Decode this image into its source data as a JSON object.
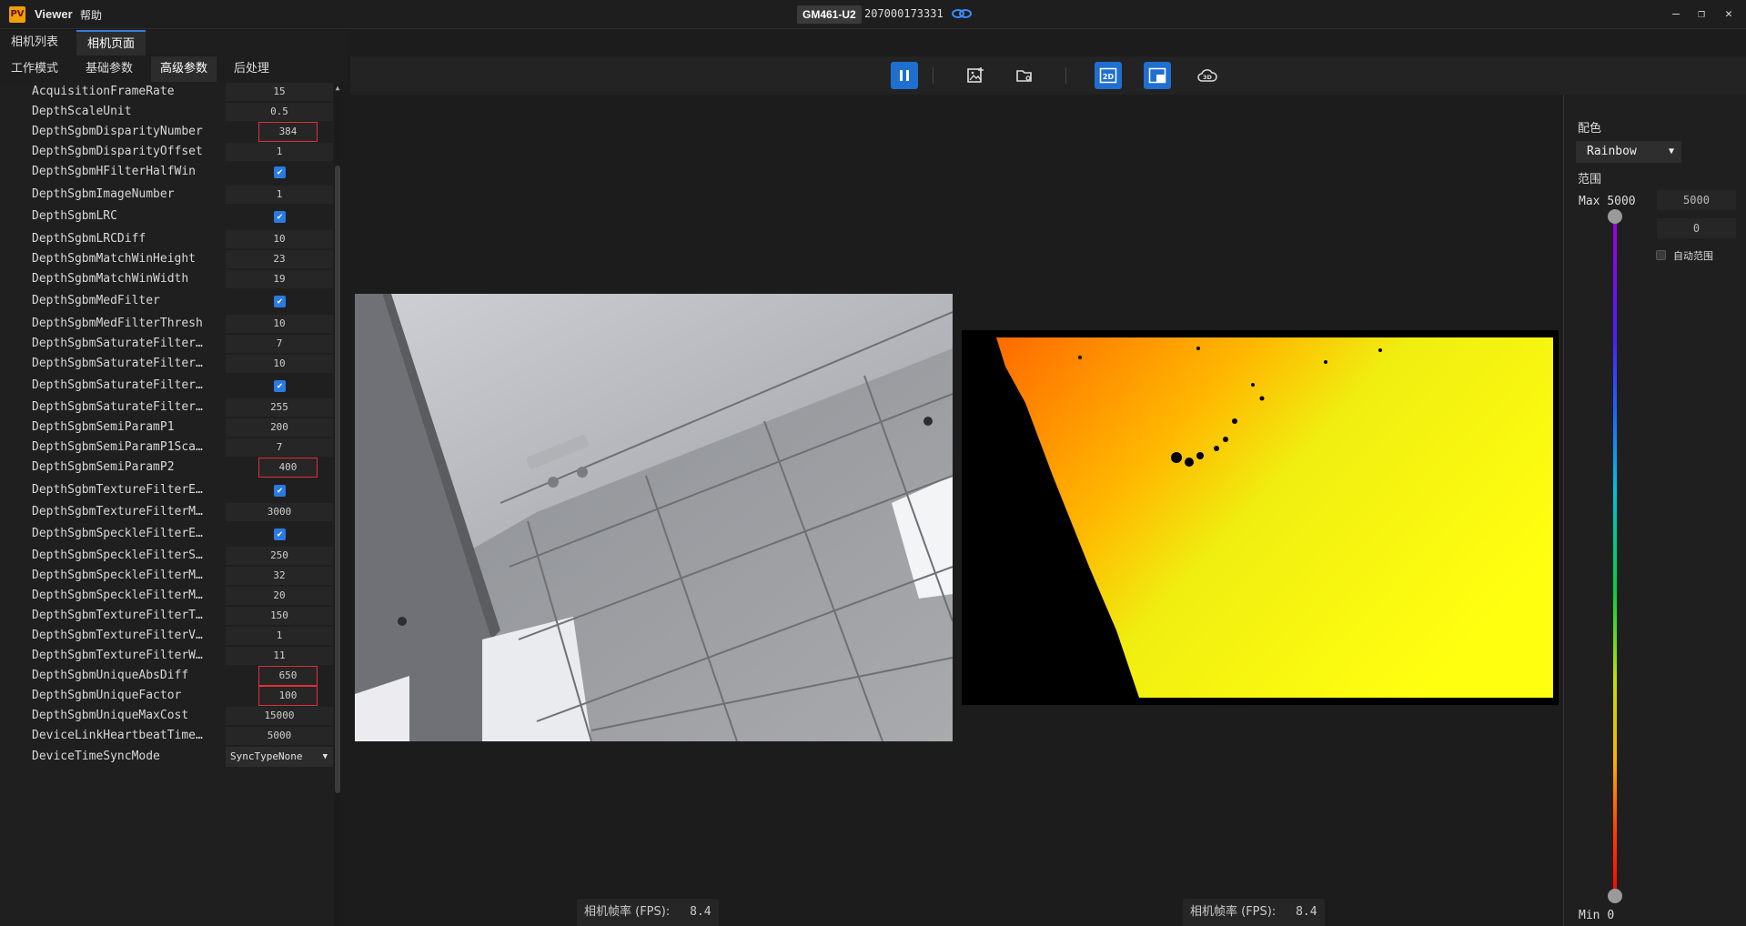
{
  "titlebar": {
    "logo_text": "PV",
    "app_title": "Viewer",
    "menu_help": "帮助",
    "camera_model": "GM461-U2",
    "camera_serial": "207000173331",
    "minimize": "–",
    "restore": "❐",
    "close": "✕"
  },
  "tabs_top": [
    "相机列表",
    "相机页面"
  ],
  "tabs_params": [
    "工作模式",
    "基础参数",
    "高级参数",
    "后处理"
  ],
  "params": [
    {
      "name": "AcquisitionFrameRate",
      "value": "15"
    },
    {
      "name": "DepthScaleUnit",
      "value": "0.5"
    },
    {
      "name": "DepthSgbmDisparityNumber",
      "value": "384",
      "highlight": true
    },
    {
      "name": "DepthSgbmDisparityOffset",
      "value": "1"
    },
    {
      "name": "DepthSgbmHFilterHalfWin",
      "checkbox": true
    },
    {
      "name": "DepthSgbmImageNumber",
      "value": "1"
    },
    {
      "name": "DepthSgbmLRC",
      "checkbox": true
    },
    {
      "name": "DepthSgbmLRCDiff",
      "value": "10"
    },
    {
      "name": "DepthSgbmMatchWinHeight",
      "value": "23"
    },
    {
      "name": "DepthSgbmMatchWinWidth",
      "value": "19"
    },
    {
      "name": "DepthSgbmMedFilter",
      "checkbox": true
    },
    {
      "name": "DepthSgbmMedFilterThresh",
      "value": "10"
    },
    {
      "name": "DepthSgbmSaturateFilter…",
      "value": "7"
    },
    {
      "name": "DepthSgbmSaturateFilter…",
      "value": "10"
    },
    {
      "name": "DepthSgbmSaturateFilter…",
      "checkbox": true
    },
    {
      "name": "DepthSgbmSaturateFilter…",
      "value": "255"
    },
    {
      "name": "DepthSgbmSemiParamP1",
      "value": "200"
    },
    {
      "name": "DepthSgbmSemiParamP1Sca…",
      "value": "7"
    },
    {
      "name": "DepthSgbmSemiParamP2",
      "value": "400",
      "highlight": true
    },
    {
      "name": "DepthSgbmTextureFilterE…",
      "checkbox": true
    },
    {
      "name": "DepthSgbmTextureFilterM…",
      "value": "3000"
    },
    {
      "name": "DepthSgbmSpeckleFilterE…",
      "checkbox": true
    },
    {
      "name": "DepthSgbmSpeckleFilterS…",
      "value": "250"
    },
    {
      "name": "DepthSgbmSpeckleFilterM…",
      "value": "32"
    },
    {
      "name": "DepthSgbmSpeckleFilterM…",
      "value": "20"
    },
    {
      "name": "DepthSgbmTextureFilterT…",
      "value": "150"
    },
    {
      "name": "DepthSgbmTextureFilterV…",
      "value": "1"
    },
    {
      "name": "DepthSgbmTextureFilterW…",
      "value": "11"
    },
    {
      "name": "DepthSgbmUniqueAbsDiff",
      "value": "650",
      "highlight": true
    },
    {
      "name": "DepthSgbmUniqueFactor",
      "value": "100",
      "highlight": true
    },
    {
      "name": "DepthSgbmUniqueMaxCost",
      "value": "15000"
    },
    {
      "name": "DeviceLinkHeartbeatTime…",
      "value": "5000"
    },
    {
      "name": "DeviceTimeSyncMode",
      "select": "SyncTypeNone"
    }
  ],
  "toolbar": {
    "pause": "pause-icon",
    "save_image": "save-image-icon",
    "open_folder": "folder-icon",
    "view_2d": "2D",
    "view_depth": "depth-overlay-icon",
    "view_3d": "3D"
  },
  "fps": {
    "label": "相机帧率 (FPS):",
    "rgb_value": "8.4",
    "depth_value": "8.4"
  },
  "right_panel": {
    "colormap_label": "配色",
    "colormap_value": "Rainbow",
    "range_label": "范围",
    "max_label": "Max",
    "max_value": "5000",
    "max_input": "5000",
    "min_input": "0",
    "auto_range_label": "自动范围",
    "auto_range_checked": false,
    "min_label": "Min",
    "min_value": "0"
  },
  "colors": {
    "accent": "#1f6fd1",
    "highlight": "#e0303a",
    "background": "#1c1c1c"
  }
}
